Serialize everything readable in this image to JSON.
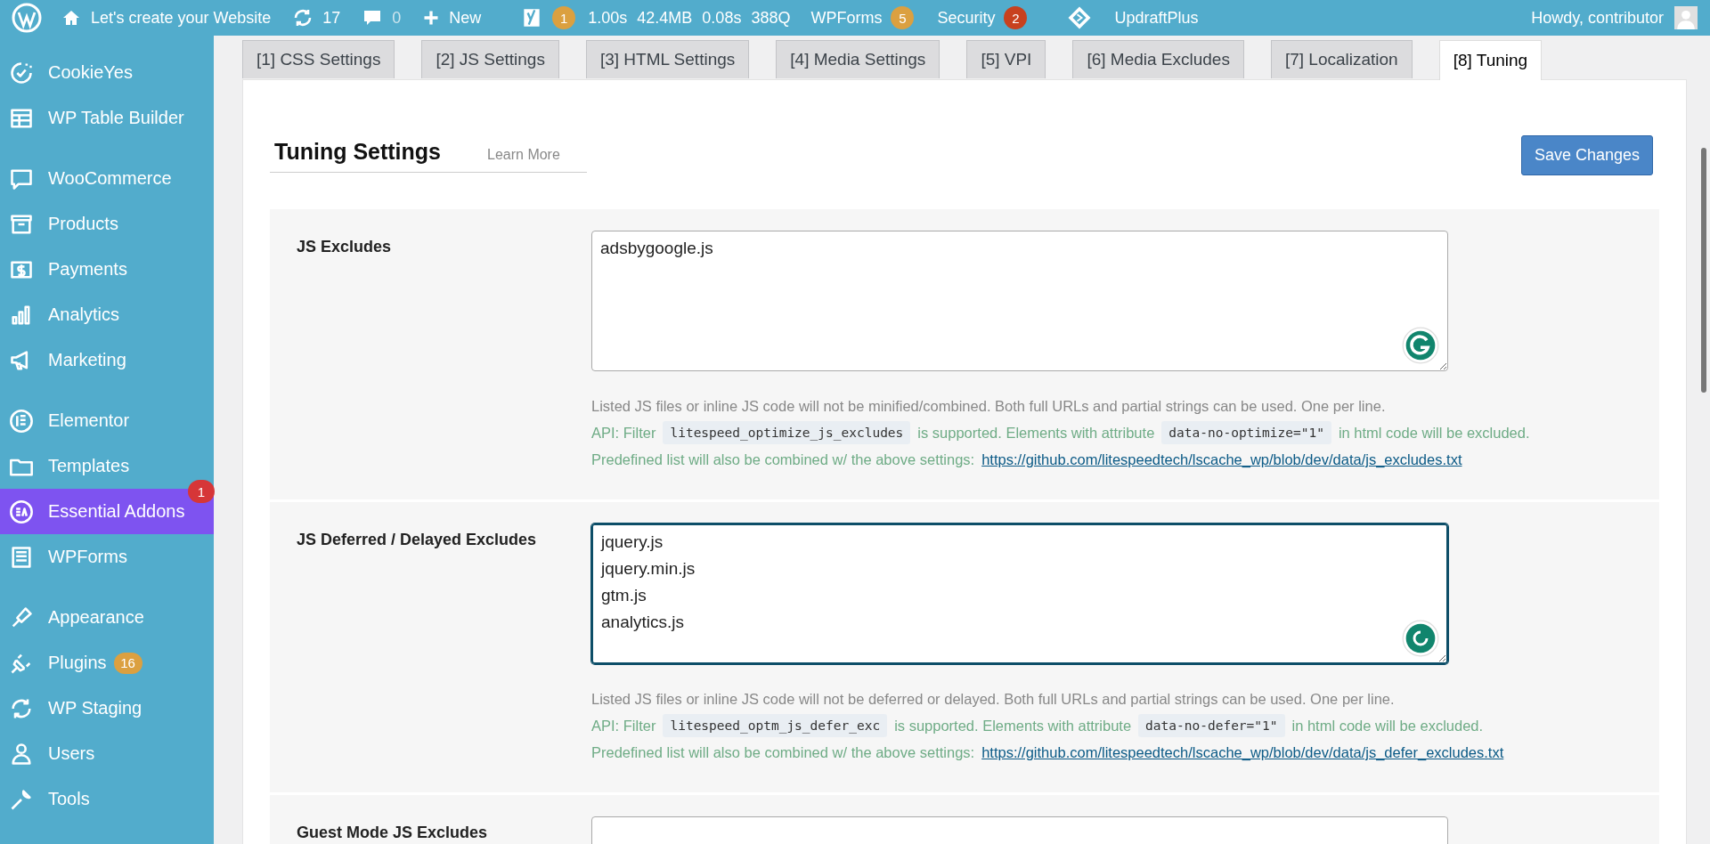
{
  "admin_bar": {
    "site_name": "Let's create your Website",
    "updates": "17",
    "comments": "0",
    "new_label": "New",
    "yoast_badge": "1",
    "stats": [
      "1.00s",
      "42.4MB",
      "0.08s",
      "388Q"
    ],
    "plugins": [
      {
        "label": "WPForms",
        "badge": "5",
        "color": "#dba040"
      },
      {
        "label": "Security",
        "badge": "2",
        "color": "#c8411e"
      }
    ],
    "updraft": "UpdraftPlus",
    "howdy": "Howdy, contributor"
  },
  "sidebar": {
    "groups": [
      [
        {
          "label": "CookieYes",
          "selected": false
        },
        {
          "label": "WP Table Builder",
          "selected": false
        }
      ],
      [
        {
          "label": "WooCommerce",
          "selected": false
        },
        {
          "label": "Products",
          "selected": false
        },
        {
          "label": "Payments",
          "selected": false
        },
        {
          "label": "Analytics",
          "selected": false
        },
        {
          "label": "Marketing",
          "selected": false
        }
      ],
      [
        {
          "label": "Elementor",
          "selected": false
        },
        {
          "label": "Templates",
          "selected": false
        },
        {
          "label": "Essential Addons",
          "selected": true,
          "badge": "1",
          "color": "#d63638"
        },
        {
          "label": "WPForms",
          "selected": false
        }
      ],
      [
        {
          "label": "Appearance",
          "selected": false
        },
        {
          "label": "Plugins",
          "selected": false,
          "badge": "16",
          "color": "#dba040"
        },
        {
          "label": "WP Staging",
          "selected": false
        },
        {
          "label": "Users",
          "selected": false
        },
        {
          "label": "Tools",
          "selected": false
        }
      ]
    ]
  },
  "tabs": [
    {
      "label": "[1] CSS Settings",
      "selected": false
    },
    {
      "label": "[2] JS Settings",
      "selected": false
    },
    {
      "label": "[3] HTML Settings",
      "selected": false
    },
    {
      "label": "[4] Media Settings",
      "selected": false
    },
    {
      "label": "[5] VPI",
      "selected": false
    },
    {
      "label": "[6] Media Excludes",
      "selected": false
    },
    {
      "label": "[7] Localization",
      "selected": false
    },
    {
      "label": "[8] Tuning",
      "selected": true
    }
  ],
  "header": {
    "title": "Tuning Settings",
    "learn_more": "Learn More",
    "save_button": "Save Changes"
  },
  "sections": [
    {
      "label": "JS Excludes",
      "value": "adsbygoogle.js",
      "focused": false,
      "grammarly_loading": false,
      "help": {
        "note": "Listed JS files or inline JS code will not be minified/combined. Both full URLs and partial strings can be used. One per line.",
        "api": [
          {
            "kind": "text",
            "text": "API: Filter"
          },
          {
            "kind": "code",
            "text": "litespeed_optimize_js_excludes"
          },
          {
            "kind": "text",
            "text": "is supported. Elements with attribute"
          },
          {
            "kind": "code",
            "text": "data-no-optimize=\"1\""
          },
          {
            "kind": "text",
            "text": "in html code will be excluded."
          }
        ],
        "predefined": "Predefined list will also be combined w/ the above settings:",
        "link": "https://github.com/litespeedtech/lscache_wp/blob/dev/data/js_excludes.txt"
      }
    },
    {
      "label": "JS Deferred / Delayed Excludes",
      "value": "jquery.js\njquery.min.js\ngtm.js\nanalytics.js\n",
      "focused": true,
      "grammarly_loading": true,
      "help": {
        "note": "Listed JS files or inline JS code will not be deferred or delayed. Both full URLs and partial strings can be used. One per line.",
        "api": [
          {
            "kind": "text",
            "text": "API: Filter"
          },
          {
            "kind": "code",
            "text": "litespeed_optm_js_defer_exc"
          },
          {
            "kind": "text",
            "text": "is supported. Elements with attribute"
          },
          {
            "kind": "code",
            "text": "data-no-defer=\"1\""
          },
          {
            "kind": "text",
            "text": "in html code will be excluded."
          }
        ],
        "predefined": "Predefined list will also be combined w/ the above settings:",
        "link": "https://github.com/litespeedtech/lscache_wp/blob/dev/data/js_defer_excludes.txt"
      }
    },
    {
      "label": "Guest Mode JS Excludes",
      "focused": false
    }
  ]
}
